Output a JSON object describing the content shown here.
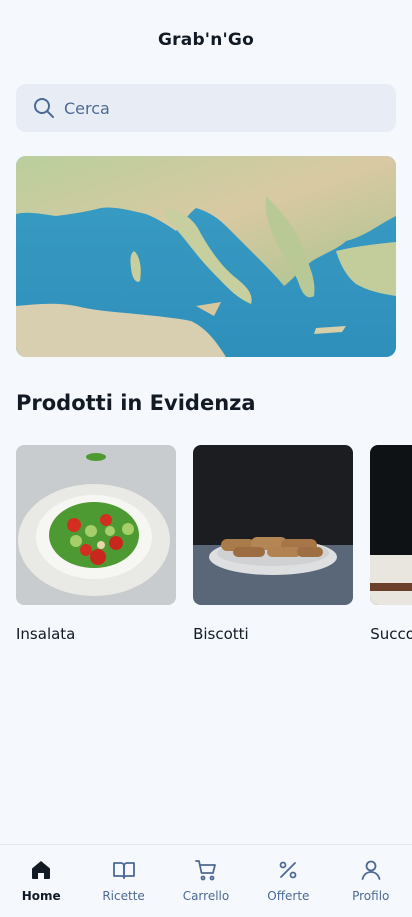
{
  "header": {
    "title": "Grab'n'Go"
  },
  "search": {
    "placeholder": "Cerca",
    "icon": "search-icon"
  },
  "banner": {
    "image": "map-of-mediterranean-italy"
  },
  "featured": {
    "title": "Prodotti in Evidenza",
    "products": [
      {
        "name": "Insalata",
        "image": "salad-plate"
      },
      {
        "name": "Biscotti",
        "image": "biscotti-plate"
      },
      {
        "name": "Succo",
        "image": "juice-glass"
      }
    ]
  },
  "nav": {
    "active": "Home",
    "items": [
      {
        "label": "Home",
        "icon": "home-icon"
      },
      {
        "label": "Ricette",
        "icon": "book-icon"
      },
      {
        "label": "Carrello",
        "icon": "cart-icon"
      },
      {
        "label": "Offerte",
        "icon": "percent-icon"
      },
      {
        "label": "Profilo",
        "icon": "user-icon"
      }
    ]
  },
  "colors": {
    "background": "#f5f8fc",
    "search_bg": "#e8edf5",
    "muted_text": "#4d6a94",
    "primary_text": "#121a26"
  }
}
